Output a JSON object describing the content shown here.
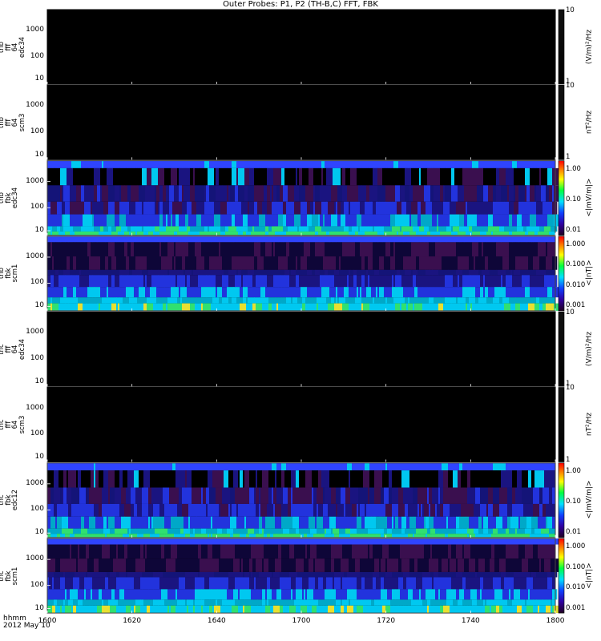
{
  "title": "Outer Probes: P1, P2 (TH-B,C) FFT, FBK",
  "x_row1": "hhmm",
  "x_row2": "2012 May 10",
  "chart_data": {
    "type": "heatmap",
    "x_ticks": [
      "1600",
      "1620",
      "1640",
      "1700",
      "1720",
      "1740",
      "1800"
    ],
    "panels": [
      {
        "label": "thb\nfff\n64\nedc34",
        "yticks": [
          "1000",
          "100",
          "10"
        ],
        "kind": "empty",
        "cbar": "gray",
        "cbar_ticks": [
          "10",
          "1"
        ],
        "unit": "(V/m)²/Hz"
      },
      {
        "label": "thb\nfff\n64\nscm3",
        "yticks": [
          "1000",
          "100",
          "10"
        ],
        "kind": "empty",
        "cbar": "gray",
        "cbar_ticks": [
          "10",
          "1"
        ],
        "unit": "nT²/Hz"
      },
      {
        "label": "thb\nfbk\nedc34",
        "yticks": [
          "1000",
          "100",
          "10"
        ],
        "kind": "fbk_e",
        "cbar": "rainbow",
        "cbar_ticks": [
          "1.00",
          "0.10",
          "0.01"
        ],
        "unit": "<|mV/m|>"
      },
      {
        "label": "thb\nfbk\nscm1",
        "yticks": [
          "1000",
          "100",
          "10"
        ],
        "kind": "fbk_b",
        "cbar": "rainbow",
        "cbar_ticks": [
          "1.000",
          "0.100",
          "0.010",
          "0.001"
        ],
        "unit": "<|nT|>"
      },
      {
        "label": "thc\nfff\n64\nedc34",
        "yticks": [
          "1000",
          "100",
          "10"
        ],
        "kind": "empty",
        "cbar": "gray",
        "cbar_ticks": [
          "10",
          "1"
        ],
        "unit": "(V/m)²/Hz"
      },
      {
        "label": "thc\nfff\n64\nscm3",
        "yticks": [
          "1000",
          "100",
          "10"
        ],
        "kind": "empty",
        "cbar": "gray",
        "cbar_ticks": [
          "10",
          "1"
        ],
        "unit": "nT²/Hz"
      },
      {
        "label": "thc\nfbk\nedc12",
        "yticks": [
          "1000",
          "100",
          "10"
        ],
        "kind": "fbk_e",
        "cbar": "rainbow",
        "cbar_ticks": [
          "1.00",
          "0.10",
          "0.01"
        ],
        "unit": "<|mV/m|>"
      },
      {
        "label": "thc\nfbk\nscm1",
        "yticks": [
          "1000",
          "100",
          "10"
        ],
        "kind": "fbk_b",
        "cbar": "rainbow",
        "cbar_ticks": [
          "1.000",
          "0.100",
          "0.010",
          "0.001"
        ],
        "unit": "<|nT|>"
      }
    ]
  }
}
